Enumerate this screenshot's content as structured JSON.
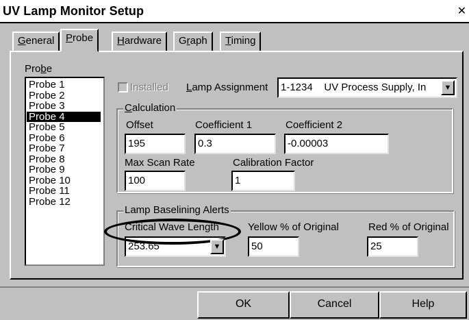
{
  "window": {
    "title": "UV Lamp Monitor Setup",
    "close_glyph": "✕"
  },
  "tabs": [
    {
      "pre": "",
      "key": "G",
      "post": "eneral"
    },
    {
      "pre": "",
      "key": "P",
      "post": "robe"
    },
    {
      "pre": "",
      "key": "H",
      "post": "ardware"
    },
    {
      "pre": "G",
      "key": "r",
      "post": "aph"
    },
    {
      "pre": "",
      "key": "T",
      "post": "iming"
    }
  ],
  "active_tab": "Probe",
  "probe_list": {
    "label_pre": "Pro",
    "label_key": "b",
    "label_post": "e",
    "items": [
      "Probe 1",
      "Probe 2",
      "Probe 3",
      "Probe 4",
      "Probe 5",
      "Probe 6",
      "Probe 7",
      "Probe 8",
      "Probe 9",
      "Probe 10",
      "Probe 11",
      "Probe 12"
    ],
    "selected": "Probe 4"
  },
  "installed": {
    "label": "Installed",
    "checked": false,
    "enabled": false
  },
  "lamp_assignment": {
    "key": "L",
    "label_rest": "amp Assignment",
    "value": "1-1234    UV Process Supply, In"
  },
  "calculation": {
    "key": "C",
    "title_rest": "alculation",
    "offset": {
      "label": "Offset",
      "value": "195"
    },
    "coefficient1": {
      "label": "Coefficient 1",
      "value": "0.3"
    },
    "coefficient2": {
      "label": "Coefficient 2",
      "value": "-0.00003"
    },
    "max_scan_rate": {
      "label": "Max Scan Rate",
      "value": "100"
    },
    "calibration_factor": {
      "label": "Calibration Factor",
      "value": "1"
    }
  },
  "baselining": {
    "title": "Lamp Baselining Alerts",
    "critical_wave_length": {
      "label": "Critical Wave Length",
      "value": "253.65"
    },
    "yellow": {
      "label": "Yellow % of Original",
      "value": "50"
    },
    "red": {
      "label": "Red % of Original",
      "value": "25"
    }
  },
  "buttons": {
    "ok": "OK",
    "cancel": "Cancel",
    "help": "Help"
  },
  "icons": {
    "dropdown": "triangle-down-icon",
    "close": "close-icon"
  }
}
